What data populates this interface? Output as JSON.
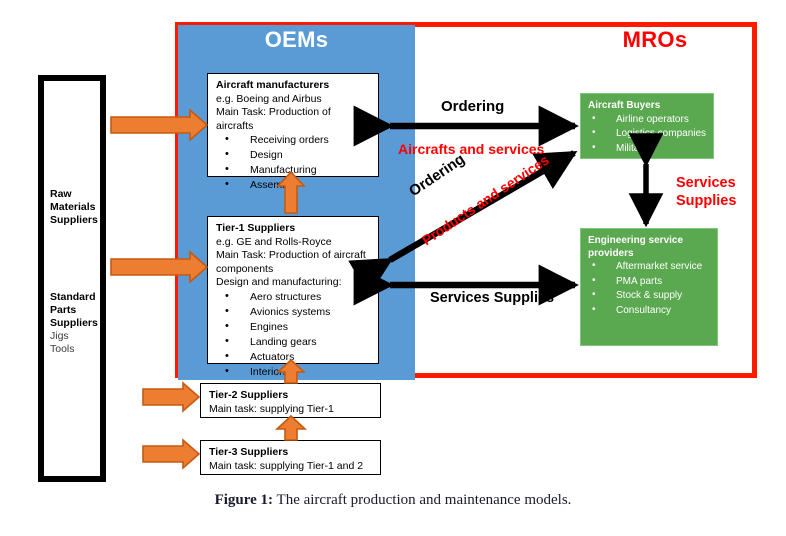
{
  "figure": {
    "caption_label": "Figure 1:",
    "caption_text": " The aircraft production and maintenance models."
  },
  "panels": {
    "oem": {
      "title": "OEMs",
      "color": "#5b9bd5"
    },
    "mro": {
      "title": "MROs",
      "color": "#ff1a00"
    }
  },
  "suppliers_column": {
    "raw_materials": "Raw\nMaterials\nSuppliers",
    "raw_materials_lines": [
      "Raw",
      "Materials",
      "Suppliers"
    ],
    "standard_parts_lines": [
      "Standard",
      "Parts",
      "Suppliers"
    ],
    "standard_parts_sub": [
      "Jigs",
      "Tools"
    ]
  },
  "boxes": {
    "aircraft_manufacturers": {
      "title": "Aircraft manufacturers",
      "line1": "e.g. Boeing and Airbus",
      "line2": "Main Task: Production of aircrafts",
      "items": [
        "Receiving orders",
        "Design",
        "Manufacturing",
        "Assembly"
      ]
    },
    "tier1_suppliers": {
      "title": "Tier-1 Suppliers",
      "line1": "e.g. GE and Rolls-Royce",
      "line2": "Main Task: Production of aircraft",
      "line3": "components",
      "line4": "Design and manufacturing:",
      "items": [
        "Aero structures",
        "Avionics systems",
        "Engines",
        "Landing gears",
        "Actuators",
        "Interiors"
      ]
    },
    "tier2_suppliers": {
      "title": "Tier-2 Suppliers",
      "line1": "Main task: supplying Tier-1"
    },
    "tier3_suppliers": {
      "title": "Tier-3 Suppliers",
      "line1": "Main task: supplying Tier-1 and 2"
    },
    "aircraft_buyers": {
      "title": "Aircraft Buyers",
      "items": [
        "Airline operators",
        "Logistics companies",
        "Military"
      ],
      "color": "#5aa84f"
    },
    "engineering_service_providers": {
      "title_line1": "Engineering service",
      "title_line2": "providers",
      "items": [
        "Aftermarket service",
        "PMA parts",
        "Stock & supply",
        "Consultancy"
      ],
      "color": "#5aa84f"
    }
  },
  "arrow_labels": {
    "ordering_top": "Ordering",
    "aircrafts_and_services": "Aircrafts and services",
    "ordering_diagonal": "Ordering",
    "products_and_services": "Products and services",
    "services_supplies_horizontal": "Services Supplies",
    "services_supplies_vertical_line1": "Services",
    "services_supplies_vertical_line2": "Supplies"
  },
  "colors": {
    "orange_arrow": "#ed7d31",
    "orange_arrow_border": "#c55a11",
    "black_arrow": "#000000",
    "red_text": "#ff0000",
    "green_box": "#5aa84f",
    "blue_panel": "#5b9bd5"
  }
}
